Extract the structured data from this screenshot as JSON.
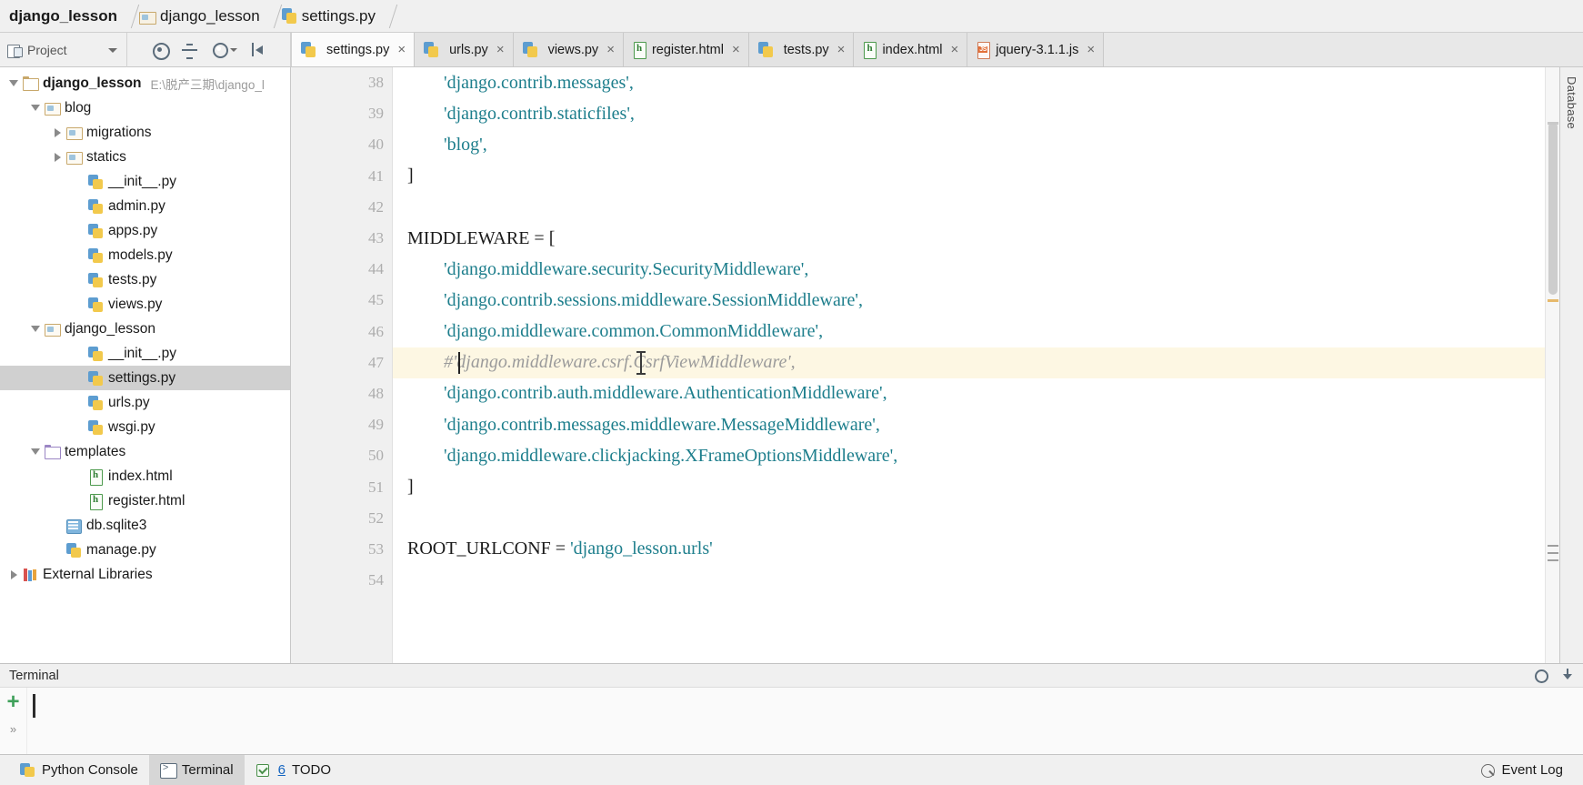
{
  "breadcrumb": {
    "items": [
      {
        "label": "django_lesson",
        "icon": "none",
        "bold": true
      },
      {
        "label": "django_lesson",
        "icon": "folder-icon",
        "bold": false
      },
      {
        "label": "settings.py",
        "icon": "python-file-icon",
        "bold": false
      }
    ]
  },
  "toolbar": {
    "project_label": "Project",
    "icons": [
      "locate-target-icon",
      "collapse-all-icon",
      "settings-gear-icon",
      "hide-panel-icon"
    ]
  },
  "editor_tabs": [
    {
      "label": "settings.py",
      "icon": "python-file-icon",
      "active": true,
      "close": "×"
    },
    {
      "label": "urls.py",
      "icon": "python-file-icon",
      "active": false,
      "close": "×"
    },
    {
      "label": "views.py",
      "icon": "python-file-icon",
      "active": false,
      "close": "×"
    },
    {
      "label": "register.html",
      "icon": "html-file-icon",
      "active": false,
      "close": "×"
    },
    {
      "label": "tests.py",
      "icon": "python-file-icon",
      "active": false,
      "close": "×"
    },
    {
      "label": "index.html",
      "icon": "html-file-icon",
      "active": false,
      "close": "×"
    },
    {
      "label": "jquery-3.1.1.js",
      "icon": "js-file-icon",
      "active": false,
      "close": "×"
    }
  ],
  "project_tree": [
    {
      "label": "django_lesson",
      "path": "E:\\脱产三期\\django_l",
      "icon": "folder-plain-icon",
      "twisty": "open",
      "indent": 0,
      "bold": true,
      "selected": false
    },
    {
      "label": "blog",
      "path": "",
      "icon": "folder-module-icon",
      "twisty": "open",
      "indent": 1,
      "bold": false,
      "selected": false
    },
    {
      "label": "migrations",
      "path": "",
      "icon": "folder-module-icon",
      "twisty": "closed",
      "indent": 2,
      "bold": false,
      "selected": false
    },
    {
      "label": "statics",
      "path": "",
      "icon": "folder-module-icon",
      "twisty": "closed",
      "indent": 2,
      "bold": false,
      "selected": false
    },
    {
      "label": "__init__.py",
      "path": "",
      "icon": "python-file-icon",
      "twisty": "none",
      "indent": 3,
      "bold": false,
      "selected": false
    },
    {
      "label": "admin.py",
      "path": "",
      "icon": "python-file-icon",
      "twisty": "none",
      "indent": 3,
      "bold": false,
      "selected": false
    },
    {
      "label": "apps.py",
      "path": "",
      "icon": "python-file-icon",
      "twisty": "none",
      "indent": 3,
      "bold": false,
      "selected": false
    },
    {
      "label": "models.py",
      "path": "",
      "icon": "python-file-icon",
      "twisty": "none",
      "indent": 3,
      "bold": false,
      "selected": false
    },
    {
      "label": "tests.py",
      "path": "",
      "icon": "python-file-icon",
      "twisty": "none",
      "indent": 3,
      "bold": false,
      "selected": false
    },
    {
      "label": "views.py",
      "path": "",
      "icon": "python-file-icon",
      "twisty": "none",
      "indent": 3,
      "bold": false,
      "selected": false
    },
    {
      "label": "django_lesson",
      "path": "",
      "icon": "folder-module-icon",
      "twisty": "open",
      "indent": 1,
      "bold": false,
      "selected": false
    },
    {
      "label": "__init__.py",
      "path": "",
      "icon": "python-file-icon",
      "twisty": "none",
      "indent": 3,
      "bold": false,
      "selected": false
    },
    {
      "label": "settings.py",
      "path": "",
      "icon": "python-file-icon",
      "twisty": "none",
      "indent": 3,
      "bold": false,
      "selected": true
    },
    {
      "label": "urls.py",
      "path": "",
      "icon": "python-file-icon",
      "twisty": "none",
      "indent": 3,
      "bold": false,
      "selected": false
    },
    {
      "label": "wsgi.py",
      "path": "",
      "icon": "python-file-icon",
      "twisty": "none",
      "indent": 3,
      "bold": false,
      "selected": false
    },
    {
      "label": "templates",
      "path": "",
      "icon": "folder-template-icon",
      "twisty": "open",
      "indent": 1,
      "bold": false,
      "selected": false
    },
    {
      "label": "index.html",
      "path": "",
      "icon": "html-file-icon",
      "twisty": "none",
      "indent": 3,
      "bold": false,
      "selected": false
    },
    {
      "label": "register.html",
      "path": "",
      "icon": "html-file-icon",
      "twisty": "none",
      "indent": 3,
      "bold": false,
      "selected": false
    },
    {
      "label": "db.sqlite3",
      "path": "",
      "icon": "database-icon",
      "twisty": "none",
      "indent": 2,
      "bold": false,
      "selected": false
    },
    {
      "label": "manage.py",
      "path": "",
      "icon": "python-file-icon",
      "twisty": "none",
      "indent": 2,
      "bold": false,
      "selected": false
    },
    {
      "label": "External Libraries",
      "path": "",
      "icon": "library-icon",
      "twisty": "closed",
      "indent": 0,
      "bold": false,
      "selected": false
    }
  ],
  "code": {
    "first_line_number": 38,
    "lines": [
      {
        "n": 38,
        "indent": 8,
        "text": "'django.contrib.messages',",
        "type": "string",
        "highlight": false,
        "fold": "none"
      },
      {
        "n": 39,
        "indent": 8,
        "text": "'django.contrib.staticfiles',",
        "type": "string",
        "highlight": false,
        "fold": "none"
      },
      {
        "n": 40,
        "indent": 8,
        "text": "'blog',",
        "type": "string",
        "highlight": false,
        "fold": "none"
      },
      {
        "n": 41,
        "indent": 0,
        "text": "]",
        "type": "plain",
        "highlight": false,
        "fold": "bottom"
      },
      {
        "n": 42,
        "indent": 0,
        "text": "",
        "type": "plain",
        "highlight": false,
        "fold": "none"
      },
      {
        "n": 43,
        "indent": 0,
        "text": "MIDDLEWARE = [",
        "type": "plain",
        "highlight": false,
        "fold": "top"
      },
      {
        "n": 44,
        "indent": 8,
        "text": "'django.middleware.security.SecurityMiddleware',",
        "type": "string",
        "highlight": false,
        "fold": "none"
      },
      {
        "n": 45,
        "indent": 8,
        "text": "'django.contrib.sessions.middleware.SessionMiddleware',",
        "type": "string",
        "highlight": false,
        "fold": "none"
      },
      {
        "n": 46,
        "indent": 8,
        "text": "'django.middleware.common.CommonMiddleware',",
        "type": "string",
        "highlight": false,
        "fold": "none"
      },
      {
        "n": 47,
        "indent": 8,
        "text": "#'django.middleware.csrf.CsrfViewMiddleware',",
        "type": "comment",
        "highlight": true,
        "fold": "none"
      },
      {
        "n": 48,
        "indent": 8,
        "text": "'django.contrib.auth.middleware.AuthenticationMiddleware',",
        "type": "string",
        "highlight": false,
        "fold": "none"
      },
      {
        "n": 49,
        "indent": 8,
        "text": "'django.contrib.messages.middleware.MessageMiddleware',",
        "type": "string",
        "highlight": false,
        "fold": "none"
      },
      {
        "n": 50,
        "indent": 8,
        "text": "'django.middleware.clickjacking.XFrameOptionsMiddleware',",
        "type": "string",
        "highlight": false,
        "fold": "none"
      },
      {
        "n": 51,
        "indent": 0,
        "text": "]",
        "type": "plain",
        "highlight": false,
        "fold": "bottom"
      },
      {
        "n": 52,
        "indent": 0,
        "text": "",
        "type": "plain",
        "highlight": false,
        "fold": "none"
      },
      {
        "n": 53,
        "indent": 0,
        "text": "ROOT_URLCONF = 'django_lesson.urls'",
        "type": "assign",
        "highlight": false,
        "fold": "none"
      },
      {
        "n": 54,
        "indent": 0,
        "text": "",
        "type": "plain",
        "highlight": false,
        "fold": "none"
      }
    ]
  },
  "right_rail": {
    "label": "Database"
  },
  "terminal": {
    "title": "Terminal",
    "add_icon": "plus-icon",
    "expand_icon": "chevrons-right-icon",
    "settings_icon": "gear-icon",
    "download_icon": "download-icon",
    "content": ""
  },
  "status_bar": {
    "items": [
      {
        "label": "Python Console",
        "icon": "python-console-icon",
        "active": false,
        "num": ""
      },
      {
        "label": "Terminal",
        "icon": "terminal-icon",
        "active": true,
        "num": ""
      },
      {
        "label": "TODO",
        "icon": "todo-icon",
        "active": false,
        "num": "6"
      }
    ],
    "event_log": {
      "label": "Event Log",
      "icon": "event-log-icon"
    }
  },
  "colors": {
    "string": "#1d7e8c",
    "comment": "#9b9b9b",
    "highlight_row": "#fdf7e3",
    "selection": "#d0d0d0",
    "accent_green": "#3fa05a"
  }
}
